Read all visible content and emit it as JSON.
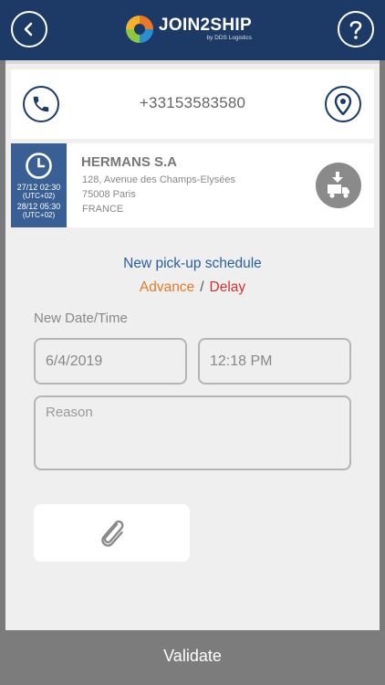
{
  "header": {
    "logo_name": "JOIN2SHIP",
    "logo_sub": "by DDS Logistics",
    "back_icon": "chevron-left-icon",
    "help_icon": "question-icon",
    "color": "#1d3a66"
  },
  "contact": {
    "phone": "+33153583580",
    "phone_icon": "phone-icon",
    "location_icon": "location-pin-icon"
  },
  "shipment": {
    "time_start": "27/12 02:30",
    "tz_start": "(UTC+02)",
    "time_end": "28/12 05:30",
    "tz_end": "(UTC+02)",
    "name": "HERMANS S.A",
    "address_line1": "128, Avenue des Champs-Elysées",
    "address_line2": "75008 Paris",
    "country": "FRANCE",
    "type_icon": "truck-pickup-icon"
  },
  "schedule": {
    "title": "New pick-up schedule",
    "advance_label": "Advance",
    "separator": "/",
    "delay_label": "Delay",
    "datetime_label": "New Date/Time",
    "date_value": "6/4/2019",
    "time_value": "12:18 PM",
    "reason_placeholder": "Reason"
  },
  "attach": {
    "icon": "paperclip-icon"
  },
  "footer": {
    "validate_label": "Validate"
  },
  "colors": {
    "accent_blue": "#2a5f9e",
    "advance": "#e8792a",
    "delay": "#d03232"
  }
}
